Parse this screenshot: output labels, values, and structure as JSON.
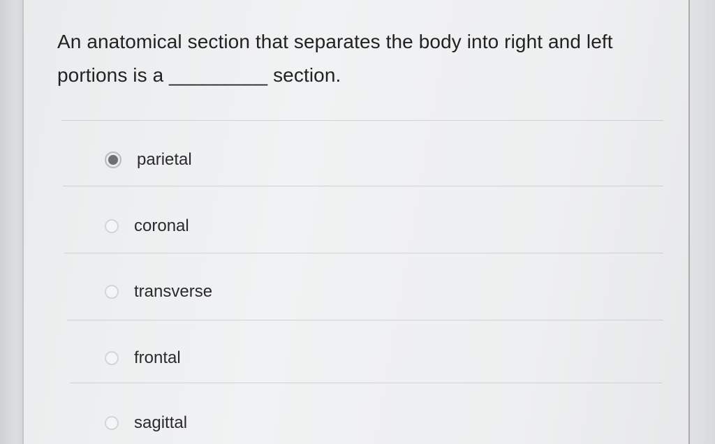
{
  "question": {
    "text": "An anatomical section that separates the body into right and left portions is a _________ section."
  },
  "options": [
    {
      "label": "parietal",
      "selected": true
    },
    {
      "label": "coronal",
      "selected": false
    },
    {
      "label": "transverse",
      "selected": false
    },
    {
      "label": "frontal",
      "selected": false
    },
    {
      "label": "sagittal",
      "selected": false
    }
  ],
  "colors": {
    "background": "#eeeff0",
    "text": "#222222",
    "divider": "#cfd2d4",
    "radio_selected_dot": "#6d7073"
  }
}
